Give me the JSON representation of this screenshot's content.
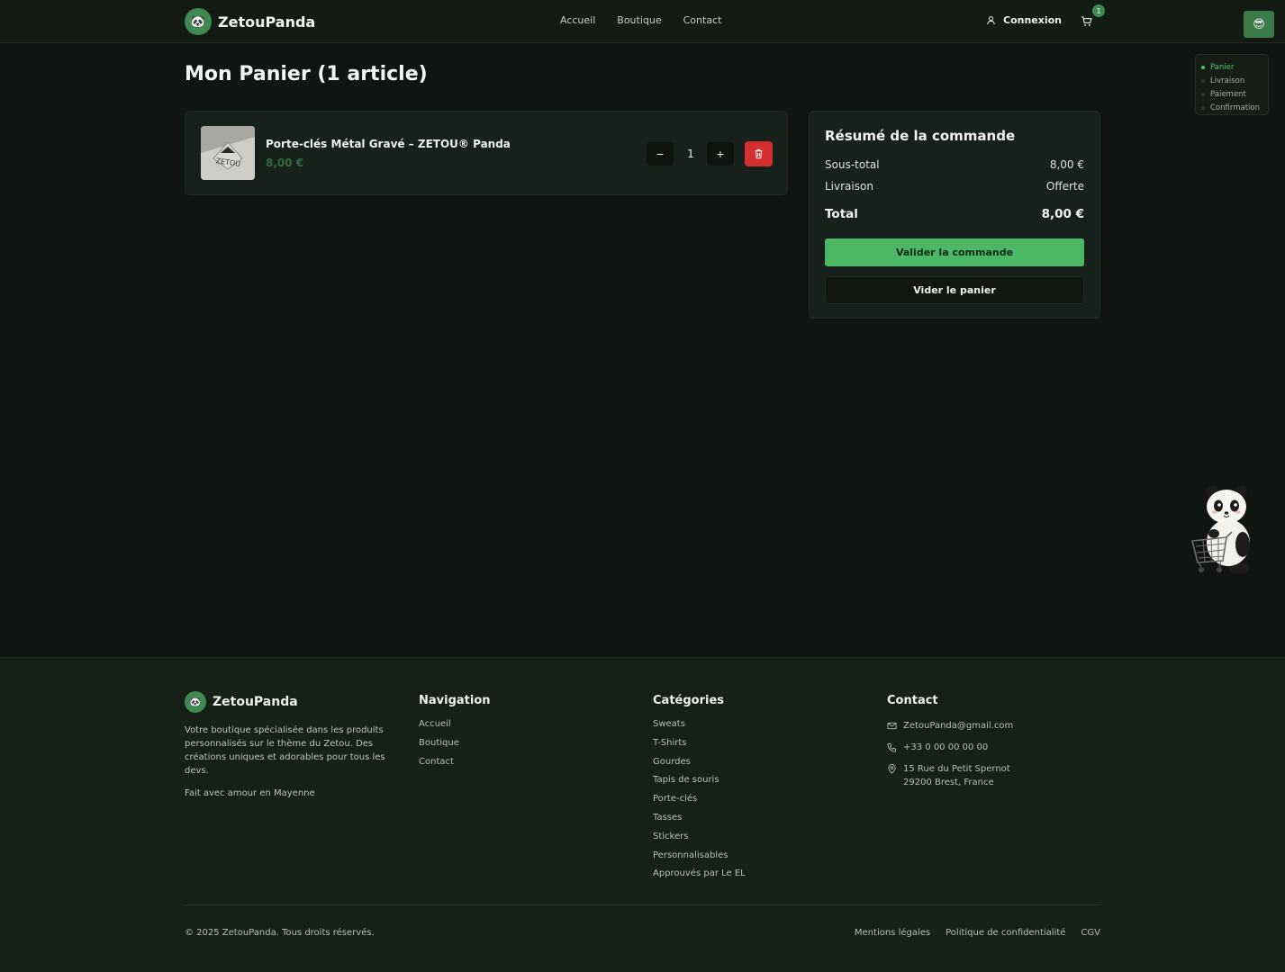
{
  "header": {
    "brand": "ZetouPanda",
    "logo_emoji": "🐼",
    "nav": [
      "Accueil",
      "Boutique",
      "Contact"
    ],
    "login_label": "Connexion",
    "cart_count": "1",
    "avatar_emoji": "😎"
  },
  "steps": [
    "Panier",
    "Livraison",
    "Paiement",
    "Confirmation"
  ],
  "cart": {
    "title": "Mon Panier (1 article)",
    "item": {
      "name": "Porte-clés Métal Gravé – ZETOU® Panda",
      "price": "8,00 €",
      "quantity": "1",
      "thumb_text": "ZETOU"
    }
  },
  "summary": {
    "title": "Résumé de la commande",
    "subtotal_label": "Sous-total",
    "subtotal_value": "8,00 €",
    "shipping_label": "Livraison",
    "shipping_value": "Offerte",
    "total_label": "Total",
    "total_value": "8,00 €",
    "validate_label": "Valider la commande",
    "clear_label": "Vider le panier"
  },
  "footer": {
    "brand": "ZetouPanda",
    "description": "Votre boutique spécialisée dans les produits personnalisés sur le thème du Zetou. Des créations uniques et adorables pour tous les devs.",
    "made_with": "Fait avec amour en Mayenne",
    "nav_title": "Navigation",
    "nav_links": [
      "Accueil",
      "Boutique",
      "Contact"
    ],
    "categories_title": "Catégories",
    "categories": [
      "Sweats",
      "T-Shirts",
      "Gourdes",
      "Tapis de souris",
      "Porte-clés",
      "Tasses",
      "Stickers",
      "Personnalisables",
      "Approuvés par Le EL"
    ],
    "contact_title": "Contact",
    "email": "ZetouPanda@gmail.com",
    "phone": "+33 0 00 00 00 00",
    "address_line1": "15 Rue du Petit Spernot",
    "address_line2": "29200 Brest, France",
    "copyright": "© 2025 ZetouPanda. Tous droits réservés.",
    "legal": [
      "Mentions légales",
      "Politique de confidentialité",
      "CGV"
    ]
  },
  "colors": {
    "accent": "#4cb765",
    "danger": "#d42f2f",
    "background": "#111511"
  }
}
